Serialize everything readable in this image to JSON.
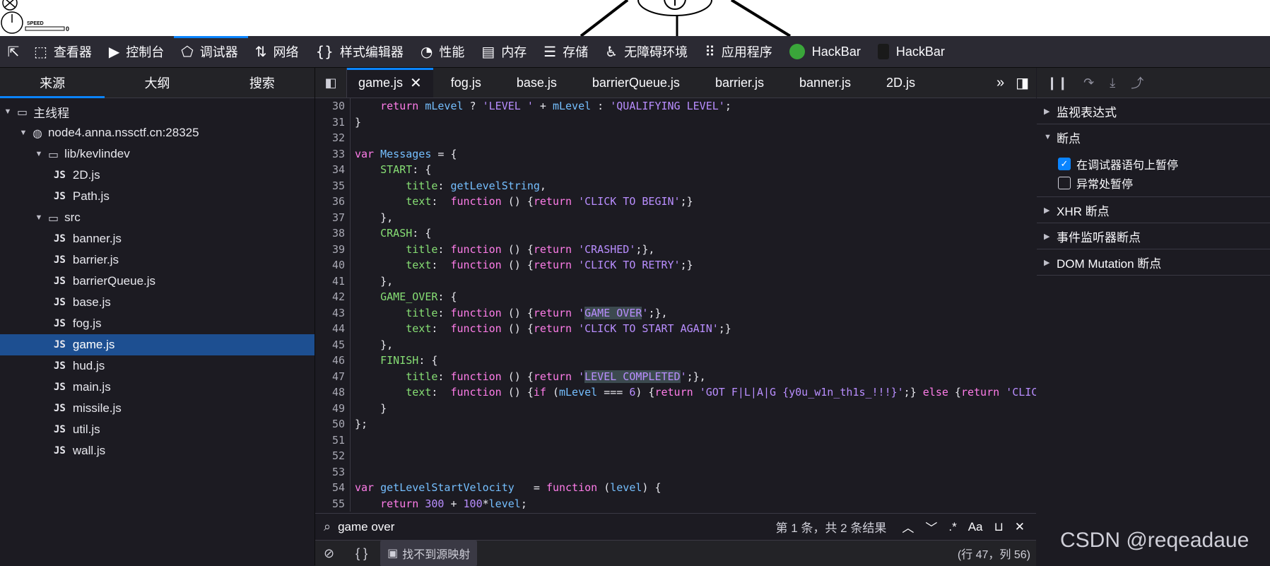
{
  "page_preview": {
    "speed_label": "SPEED",
    "speed_value": "0"
  },
  "toolbar": {
    "tabs": [
      {
        "icon": "⬚",
        "label": "查看器"
      },
      {
        "icon": "▶",
        "label": "控制台"
      },
      {
        "icon": "⬠",
        "label": "调试器"
      },
      {
        "icon": "⇅",
        "label": "网络"
      },
      {
        "icon": "{}",
        "label": "样式编辑器"
      },
      {
        "icon": "◔",
        "label": "性能"
      },
      {
        "icon": "▤",
        "label": "内存"
      },
      {
        "icon": "☰",
        "label": "存储"
      },
      {
        "icon": "♿",
        "label": "无障碍环境"
      },
      {
        "icon": "⠿",
        "label": "应用程序"
      },
      {
        "icon": "",
        "label": "HackBar"
      },
      {
        "icon": "",
        "label": "HackBar"
      }
    ]
  },
  "sources": {
    "tabs": [
      "来源",
      "大纲",
      "搜索"
    ],
    "tree": {
      "main_thread": "主线程",
      "host": "node4.anna.nssctf.cn:28325",
      "folder1": "lib/kevlindev",
      "folder1_files": [
        "2D.js",
        "Path.js"
      ],
      "folder2": "src",
      "folder2_files": [
        "banner.js",
        "barrier.js",
        "barrierQueue.js",
        "base.js",
        "fog.js",
        "game.js",
        "hud.js",
        "main.js",
        "missile.js",
        "util.js",
        "wall.js"
      ],
      "js_badge": "JS"
    }
  },
  "editor": {
    "tabs": [
      "game.js",
      "fog.js",
      "base.js",
      "barrierQueue.js",
      "barrier.js",
      "banner.js",
      "2D.js"
    ],
    "close_glyph": "✕",
    "line_numbers": [
      "30",
      "31",
      "32",
      "33",
      "34",
      "35",
      "36",
      "37",
      "38",
      "39",
      "40",
      "41",
      "42",
      "43",
      "44",
      "45",
      "46",
      "47",
      "48",
      "49",
      "50",
      "51",
      "52",
      "53",
      "54",
      "55"
    ],
    "search": {
      "query": "game over",
      "result": "第 1 条，共 2 条结果",
      "regex": ".*",
      "case": "Aa"
    },
    "footer": {
      "no_source_map": "找不到源映射",
      "position": "(行 47，列 56)",
      "pretty": "{ }"
    }
  },
  "debugger": {
    "watch": "监视表达式",
    "breakpoints": "断点",
    "pause_on_debugger": "在调试器语句上暂停",
    "pause_on_exceptions": "异常处暂停",
    "xhr": "XHR 断点",
    "event_listeners": "事件监听器断点",
    "dom_mutation": "DOM Mutation 断点"
  },
  "watermark": "CSDN @reqeadaue"
}
